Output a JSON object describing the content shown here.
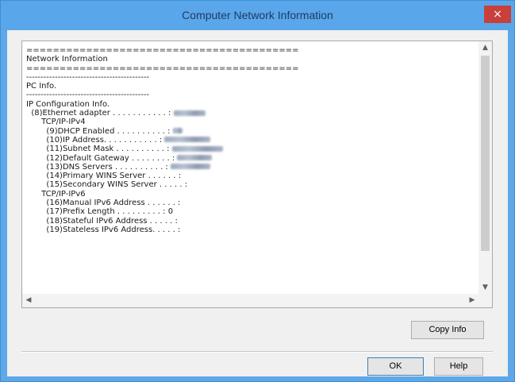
{
  "window": {
    "title": "Computer Network Information",
    "close_label": "×"
  },
  "info_text": {
    "line_01": "=========================================",
    "line_02": "Network Information",
    "line_03": "=========================================",
    "line_04": "",
    "line_05": "-------------------------------------------",
    "line_06": "PC Info.",
    "line_07": "-------------------------------------------",
    "line_08": "",
    "line_09": "IP Configuration Info.",
    "line_10": "  (8)Ethernet adapter . . . . . . . . . . . : ",
    "line_11": "      TCP/IP-IPv4",
    "line_12": "        (9)DHCP Enabled . . . . . . . . . . : ",
    "line_13": "        (10)IP Address. . . . . . . . . . . : ",
    "line_14": "        (11)Subnet Mask . . . . . . . . . . : ",
    "line_15": "        (12)Default Gateway . . . . . . . . : ",
    "line_16": "        (13)DNS Servers . . . . . . . . . . : ",
    "line_17": "        (14)Primary WINS Server . . . . . . :",
    "line_18": "        (15)Secondary WINS Server . . . . . :",
    "line_19": "      TCP/IP-IPv6",
    "line_20": "        (16)Manual IPv6 Address . . . . . . :",
    "line_21": "        (17)Prefix Length . . . . . . . . . : ",
    "line_22": "        (18)Stateful IPv6 Address . . . . . :",
    "line_23": "        (19)Stateless IPv6 Address. . . . . :",
    "prefix_length_value": "0"
  },
  "scrollbars": {
    "up_arrow": "▲",
    "down_arrow": "▼",
    "left_arrow": "◀",
    "right_arrow": "▶"
  },
  "buttons": {
    "copy_info": "Copy Info",
    "ok": "OK",
    "help": "Help"
  },
  "colors": {
    "title_bar": "#5aa6ea",
    "close_button": "#c8403a",
    "dialog_background": "#f0f0f0"
  }
}
